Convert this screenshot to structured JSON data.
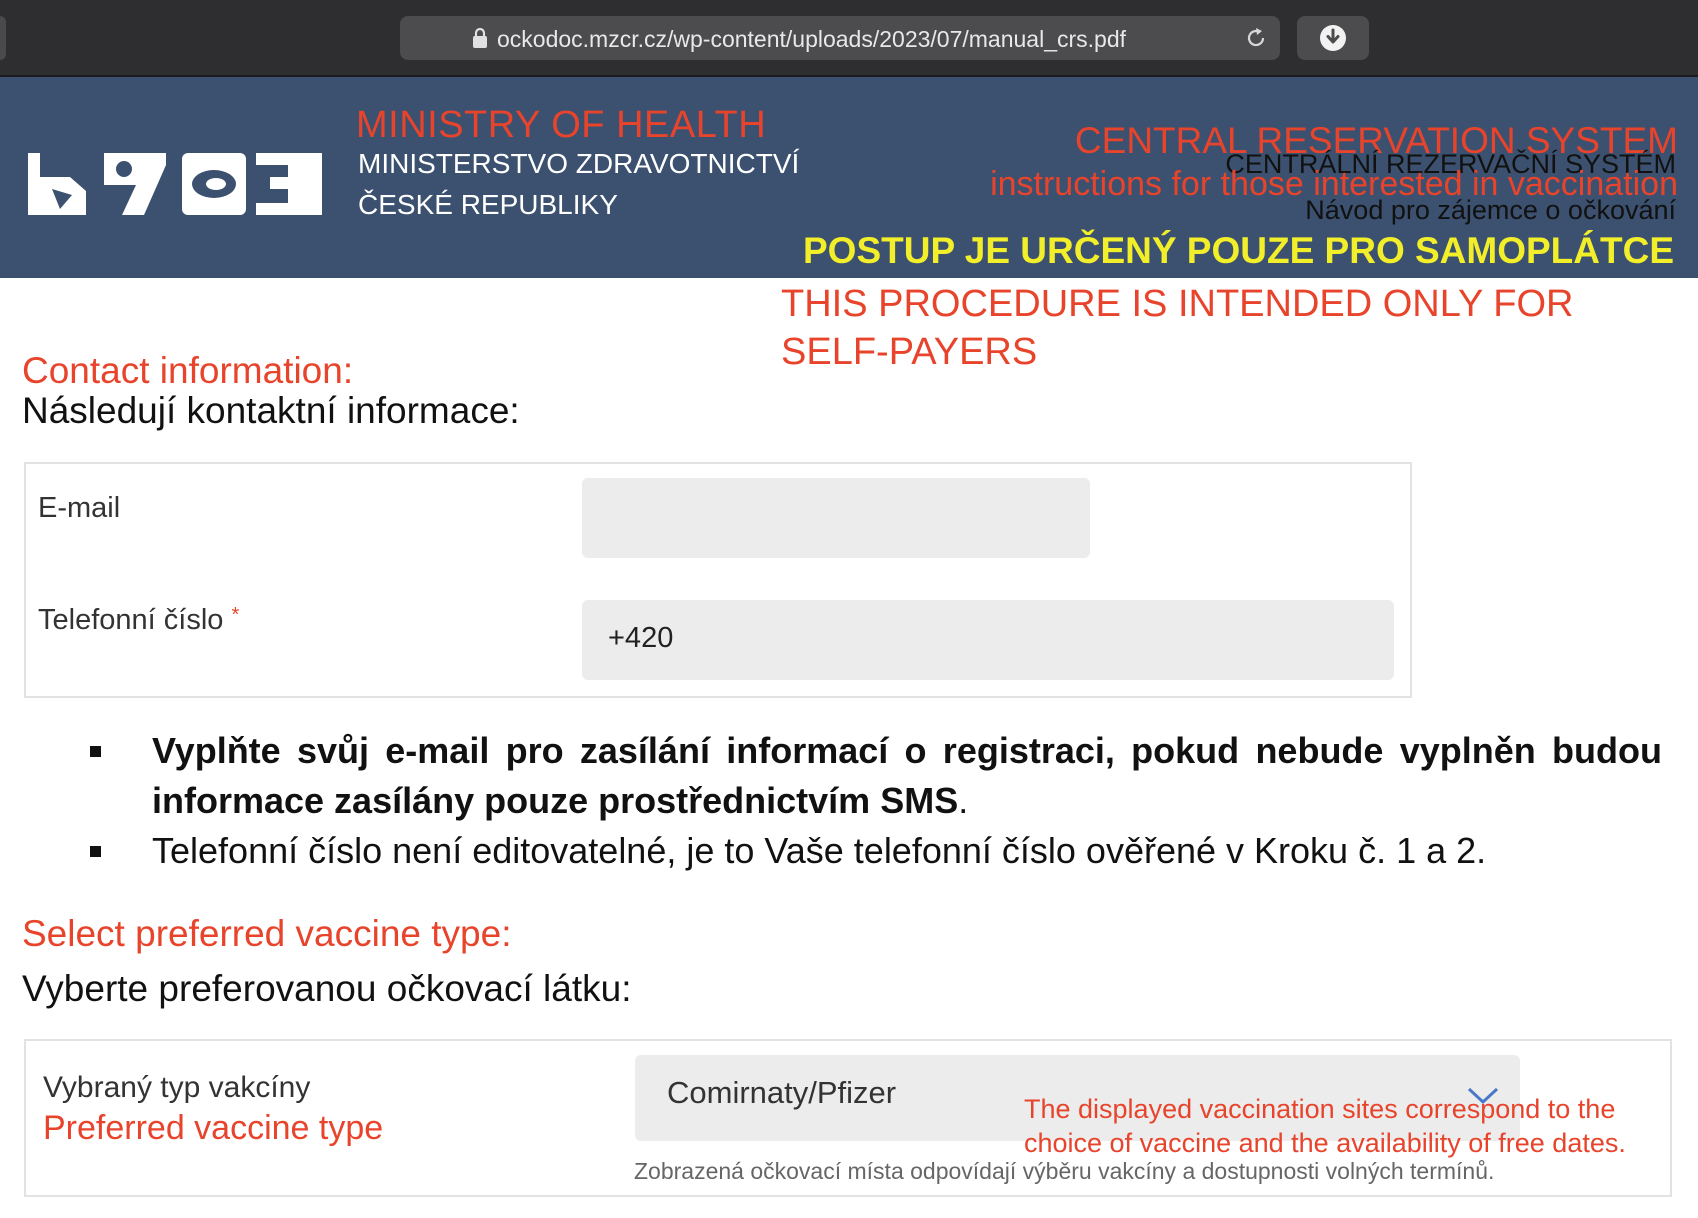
{
  "browser": {
    "url": "ockodoc.mzcr.cz/wp-content/uploads/2023/07/manual_crs.pdf"
  },
  "header": {
    "ministry_en": "MINISTRY OF HEALTH",
    "ministry_cz_line1": "MINISTERSTVO ZDRAVOTNICTVÍ",
    "ministry_cz_line2": "ČESKÉ REPUBLIKY",
    "system_en": "CENTRAL RESERVATION SYSTEM",
    "system_cz": "CENTRÁLNÍ REZERVAČNÍ SYSTÉM",
    "instructions_en": "instructions for those interested in vaccination",
    "instructions_cz": "Návod pro zájemce o očkování",
    "notice_cz": "POSTUP JE URČENÝ POUZE PRO SAMOPLÁTCE",
    "notice_en": "THIS PROCEDURE IS INTENDED ONLY FOR SELF-PAYERS"
  },
  "contact": {
    "heading_en": "Contact information:",
    "heading_cz": "Následují kontaktní informace:",
    "email_label": "E-mail",
    "email_value": "",
    "phone_label": "Telefonní číslo",
    "phone_required_mark": "*",
    "phone_value": "+420"
  },
  "bullets": {
    "item1_bold": "Vyplňte svůj e-mail pro zasílání informací o registraci, pokud nebude vyplněn budou informace zasílány pouze prostřednictvím SMS",
    "item1_tail": ".",
    "item2": "Telefonní číslo není editovatelné, je to Vaše telefonní číslo ověřené v Kroku č. 1 a 2."
  },
  "vaccine": {
    "heading_en": "Select preferred vaccine type:",
    "heading_cz": "Vyberte preferovanou očkovací látku:",
    "label_cz": "Vybraný typ vakcíny",
    "label_en": "Preferred vaccine type",
    "selected_value": "Comirnaty/Pfizer",
    "note_en_line1": "The displayed vaccination sites correspond to the",
    "note_en_line2": "choice of vaccine and the availability of free dates.",
    "note_cz": "Zobrazená očkovací místa odpovídají výběru vakcíny a dostupnosti volných termínů."
  },
  "colors": {
    "banner": "#3b516f",
    "accent_red": "#e8442c",
    "notice_yellow": "#f2ee2a",
    "input_bg": "#ececec"
  },
  "icons": [
    "lock-icon",
    "reload-icon",
    "download-icon",
    "chevron-down-icon",
    "ministry-logo"
  ]
}
